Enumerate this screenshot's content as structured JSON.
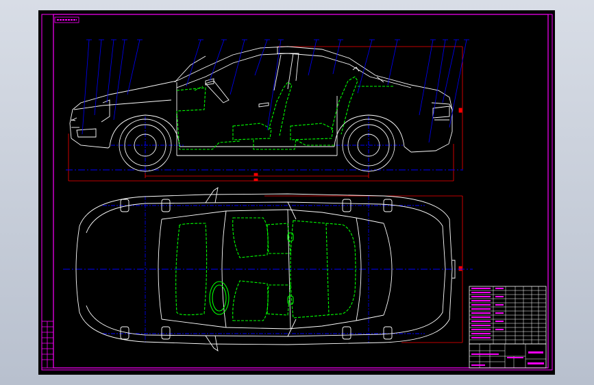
{
  "viewport": {
    "background": "#c9d0dc",
    "canvas": "#000000"
  },
  "colors": {
    "frame": "#ff00ff",
    "body_outline": "#ffffff",
    "interior": "#00ff00",
    "leaders": "#0000ff",
    "centerline": "#0000ff",
    "dimension": "#ff0000",
    "table_lines": "#ffffff",
    "table_fill": "#ff00ff"
  },
  "drawing": {
    "title_tag_text": "",
    "dimension_labels": [
      "",
      ""
    ],
    "icons": [
      "car-side-view",
      "car-top-view",
      "seat",
      "steering-wheel",
      "spare-tire"
    ]
  },
  "title_block": {
    "rows": 13,
    "cols": 8
  },
  "revision_block": {
    "rows": 8
  }
}
